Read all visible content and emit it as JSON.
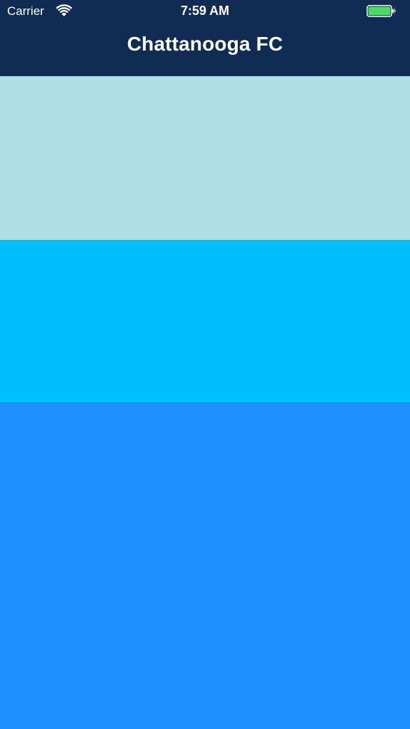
{
  "status_bar": {
    "carrier": "Carrier",
    "time": "7:59 AM",
    "wifi_icon": "wifi-icon",
    "battery_icon": "battery-charging-icon"
  },
  "nav": {
    "title": "Chattanooga FC"
  },
  "colors": {
    "nav_background": "#112c53",
    "panel_1": "#b0dfe5",
    "panel_2": "#00bfff",
    "panel_3": "#1e90ff",
    "battery_fill": "#4cd964"
  }
}
